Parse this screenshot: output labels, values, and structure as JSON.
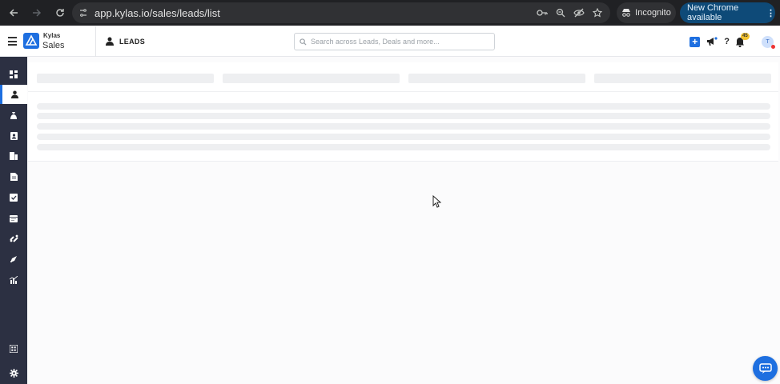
{
  "browser": {
    "url": "app.kylas.io/sales/leads/list",
    "incognito_label": "Incognito",
    "update_label": "New Chrome available"
  },
  "app": {
    "brand_small": "Kylas",
    "brand_product": "Sales",
    "page_title": "LEADS",
    "accent": "#1e6fe0",
    "sidebar_bg": "#2c3042"
  },
  "search": {
    "placeholder": "Search across Leads, Deals and more..."
  },
  "notifications": {
    "count": "45"
  },
  "user": {
    "initial": "T"
  },
  "sidebar": {
    "items": [
      {
        "icon": "dashboard-icon"
      },
      {
        "icon": "leads-icon",
        "active": true
      },
      {
        "icon": "deals-icon"
      },
      {
        "icon": "contacts-icon"
      },
      {
        "icon": "companies-icon"
      },
      {
        "icon": "documents-icon"
      },
      {
        "icon": "tasks-icon"
      },
      {
        "icon": "calendar-icon"
      },
      {
        "icon": "workflow-icon"
      },
      {
        "icon": "marketing-icon"
      },
      {
        "icon": "reports-icon"
      }
    ],
    "bottom": [
      {
        "icon": "apps-icon"
      },
      {
        "icon": "settings-icon"
      }
    ]
  }
}
